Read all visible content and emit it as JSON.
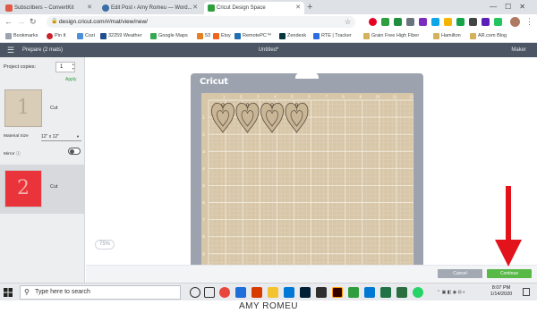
{
  "browser": {
    "tabs": [
      {
        "title": "Subscribers – ConvertKit",
        "favicon_color": "#e05a47",
        "active": false
      },
      {
        "title": "Edit Post ‹ Amy Romeu — Word...",
        "favicon_color": "#3b6ea5",
        "active": false
      },
      {
        "title": "Cricut Design Space",
        "favicon_color": "#2e9e3e",
        "active": true
      }
    ],
    "url": "design.cricut.com/#/mat/view/new/",
    "bookmarks": [
      {
        "label": "Bookmarks",
        "color": "#666666"
      },
      {
        "label": "Pin It",
        "color": "#c8232c"
      },
      {
        "label": "Cozi",
        "color": "#4a90d9"
      },
      {
        "label": "32259 Weather",
        "color": "#1f4e8c"
      },
      {
        "label": "Google Maps",
        "color": "#34a853"
      },
      {
        "label": "53",
        "color": "#e67e22"
      },
      {
        "label": "Etsy",
        "color": "#f1641e"
      },
      {
        "label": "RemotePC™",
        "color": "#1f6fb2"
      },
      {
        "label": "Zendesk",
        "color": "#03363d"
      },
      {
        "label": "RTE | Tracker",
        "color": "#2d6cdf"
      },
      {
        "label": "Grain Free High Fiber",
        "color": "#b39b62"
      },
      {
        "label": "Hamilton",
        "color": "#b39b62"
      },
      {
        "label": "AR.com Blog",
        "color": "#b39b62"
      }
    ]
  },
  "app": {
    "prepare_title": "Prepare (2 mats)",
    "document_title": "Untitled*",
    "maker_label": "Maker",
    "project_copies_label": "Project copies:",
    "project_copies_value": "1",
    "apply_label": "Apply",
    "mats": [
      {
        "number": "1",
        "label": "Cut",
        "color": "#d9cdb8"
      },
      {
        "number": "2",
        "label": "Cut",
        "color": "#e8343a"
      }
    ],
    "material_size_label": "Material Size",
    "material_size_value": "12\" x 12\"",
    "mirror_label": "Mirror ⓘ",
    "mirror_on": false,
    "mat_logo": "Cricut",
    "ruler_top": [
      "1",
      "2",
      "3",
      "4",
      "5",
      "6",
      "7",
      "8",
      "9",
      "10",
      "11",
      "12"
    ],
    "ruler_left": [
      "1",
      "2",
      "3",
      "4",
      "5",
      "6",
      "7",
      "8",
      "9"
    ],
    "zoom_level": "75%",
    "cancel_label": "Cancel",
    "continue_label": "Continue",
    "colors": {
      "header": "#4b5563",
      "mat": "#9ca3af",
      "grid_bg": "#d7c6a8",
      "continue": "#58b947",
      "arrow": "#e3131b"
    }
  },
  "taskbar": {
    "search_placeholder": "Type here to search",
    "time": "8:07 PM",
    "date": "1/14/2020"
  },
  "watermark": "AMY ROMEU"
}
